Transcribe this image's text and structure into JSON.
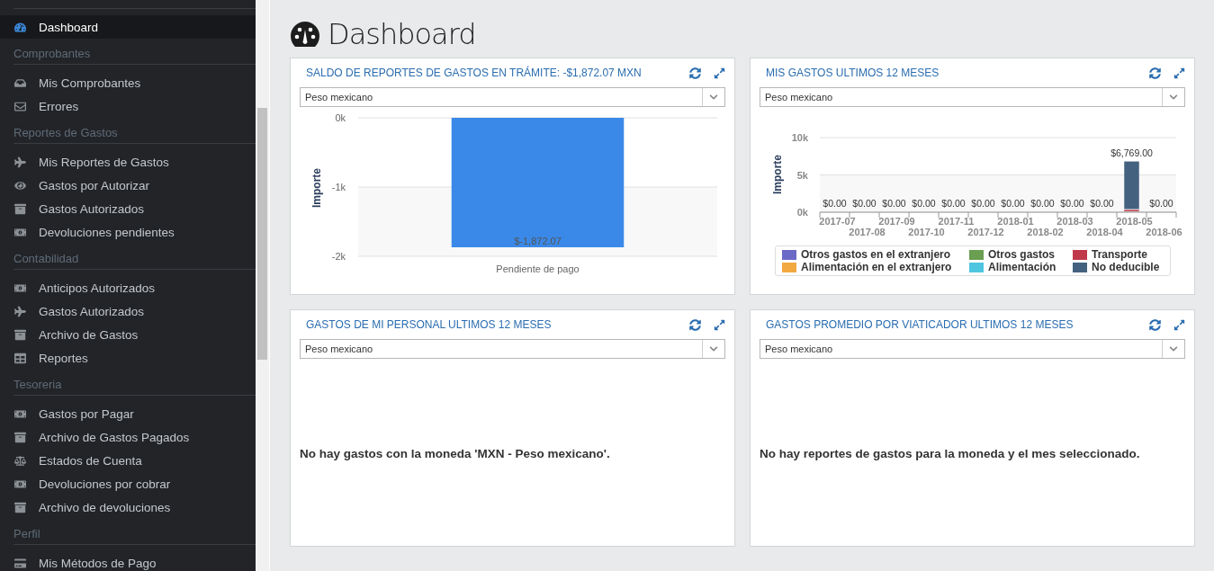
{
  "sidebar": {
    "items": [
      {
        "label": "Dashboard",
        "selected": true
      }
    ],
    "sections": [
      {
        "title": "Comprobantes",
        "items": [
          {
            "label": "Mis Comprobantes",
            "selected": false
          },
          {
            "label": "Errores",
            "selected": false
          }
        ]
      },
      {
        "title": "Reportes de Gastos",
        "items": [
          {
            "label": "Mis Reportes de Gastos",
            "selected": false
          },
          {
            "label": "Gastos por Autorizar",
            "selected": false
          },
          {
            "label": "Gastos Autorizados",
            "selected": false
          },
          {
            "label": "Devoluciones pendientes",
            "selected": false
          }
        ]
      },
      {
        "title": "Contabilidad",
        "items": [
          {
            "label": "Anticipos Autorizados",
            "selected": false
          },
          {
            "label": "Gastos Autorizados",
            "selected": false
          },
          {
            "label": "Archivo de Gastos",
            "selected": false
          },
          {
            "label": "Reportes",
            "selected": false
          }
        ]
      },
      {
        "title": "Tesoreria",
        "items": [
          {
            "label": "Gastos por Pagar",
            "selected": false
          },
          {
            "label": "Archivo de Gastos Pagados",
            "selected": false
          },
          {
            "label": "Estados de Cuenta",
            "selected": false
          },
          {
            "label": "Devoluciones por cobrar",
            "selected": false
          },
          {
            "label": "Archivo de devoluciones",
            "selected": false
          }
        ]
      },
      {
        "title": "Perfil",
        "items": [
          {
            "label": "Mis Métodos de Pago",
            "selected": false
          }
        ]
      }
    ]
  },
  "page": {
    "title": "Dashboard"
  },
  "widgets": [
    {
      "kind": "bar",
      "title": "SALDO DE REPORTES DE GASTOS EN TRÁMITE: -$1,872.07 MXN",
      "currency": "Peso mexicano",
      "chart_data": {
        "type": "bar",
        "ylabel": "Importe",
        "categories": [
          "Pendiente de pago"
        ],
        "series": [
          {
            "color": "#3a89e8",
            "values": [
              -1870
            ]
          }
        ],
        "ylim": [
          -2000,
          0
        ],
        "yticks": [
          {
            "value": 0,
            "label": "0k"
          },
          {
            "value": -1000,
            "label": "-1k"
          },
          {
            "value": -2000,
            "label": "-2k"
          }
        ],
        "value_labels": [
          "$-1,872.07"
        ]
      }
    },
    {
      "kind": "stacked",
      "title": "MIS GASTOS ULTIMOS 12 MESES",
      "currency": "Peso mexicano",
      "chart_data": {
        "type": "bar",
        "stacked": true,
        "ylabel": "Importe",
        "categories": [
          "2017-07",
          "2017-08",
          "2017-09",
          "2017-10",
          "2017-11",
          "2017-12",
          "2018-01",
          "2018-02",
          "2018-03",
          "2018-04",
          "2018-05",
          "2018-06"
        ],
        "series": [
          {
            "name": "Otros gastos en el extranjero",
            "color": "#6b69c6",
            "values": [
              0,
              0,
              0,
              0,
              0,
              0,
              0,
              0,
              0,
              0,
              0,
              0
            ]
          },
          {
            "name": "Otros gastos",
            "color": "#6a9e50",
            "values": [
              0,
              0,
              0,
              0,
              0,
              0,
              0,
              0,
              0,
              0,
              0,
              0
            ]
          },
          {
            "name": "Transporte",
            "color": "#c0394a",
            "values": [
              0,
              0,
              0,
              0,
              0,
              0,
              0,
              0,
              0,
              0,
              300,
              0
            ]
          },
          {
            "name": "Alimentación en el extranjero",
            "color": "#f3a941",
            "values": [
              0,
              0,
              0,
              0,
              0,
              0,
              0,
              0,
              0,
              0,
              0,
              0
            ]
          },
          {
            "name": "Alimentación",
            "color": "#4fc6e0",
            "values": [
              0,
              0,
              0,
              0,
              0,
              0,
              0,
              0,
              0,
              0,
              0,
              0
            ]
          },
          {
            "name": "No deducible",
            "color": "#44627f",
            "values": [
              0,
              0,
              0,
              0,
              0,
              0,
              0,
              0,
              0,
              0,
              6500,
              0
            ]
          }
        ],
        "ylim": [
          0,
          10000
        ],
        "yticks": [
          {
            "value": 0,
            "label": "0k"
          },
          {
            "value": 5000,
            "label": "5k"
          },
          {
            "value": 10000,
            "label": "10k"
          }
        ],
        "value_labels": [
          "$0.00",
          "$0.00",
          "$0.00",
          "$0.00",
          "$0.00",
          "$0.00",
          "$0.00",
          "$0.00",
          "$0.00",
          "$0.00",
          "$6,769.00",
          "$0.00"
        ]
      }
    },
    {
      "kind": "empty",
      "title": "GASTOS DE MI PERSONAL ULTIMOS 12 MESES",
      "currency": "Peso mexicano",
      "message": "No hay gastos con la moneda 'MXN - Peso mexicano'."
    },
    {
      "kind": "empty",
      "title": "GASTOS PROMEDIO POR VIATICADOR ULTIMOS 12 MESES",
      "currency": "Peso mexicano",
      "message": "No hay reportes de gastos para la moneda y el mes seleccionado."
    }
  ]
}
